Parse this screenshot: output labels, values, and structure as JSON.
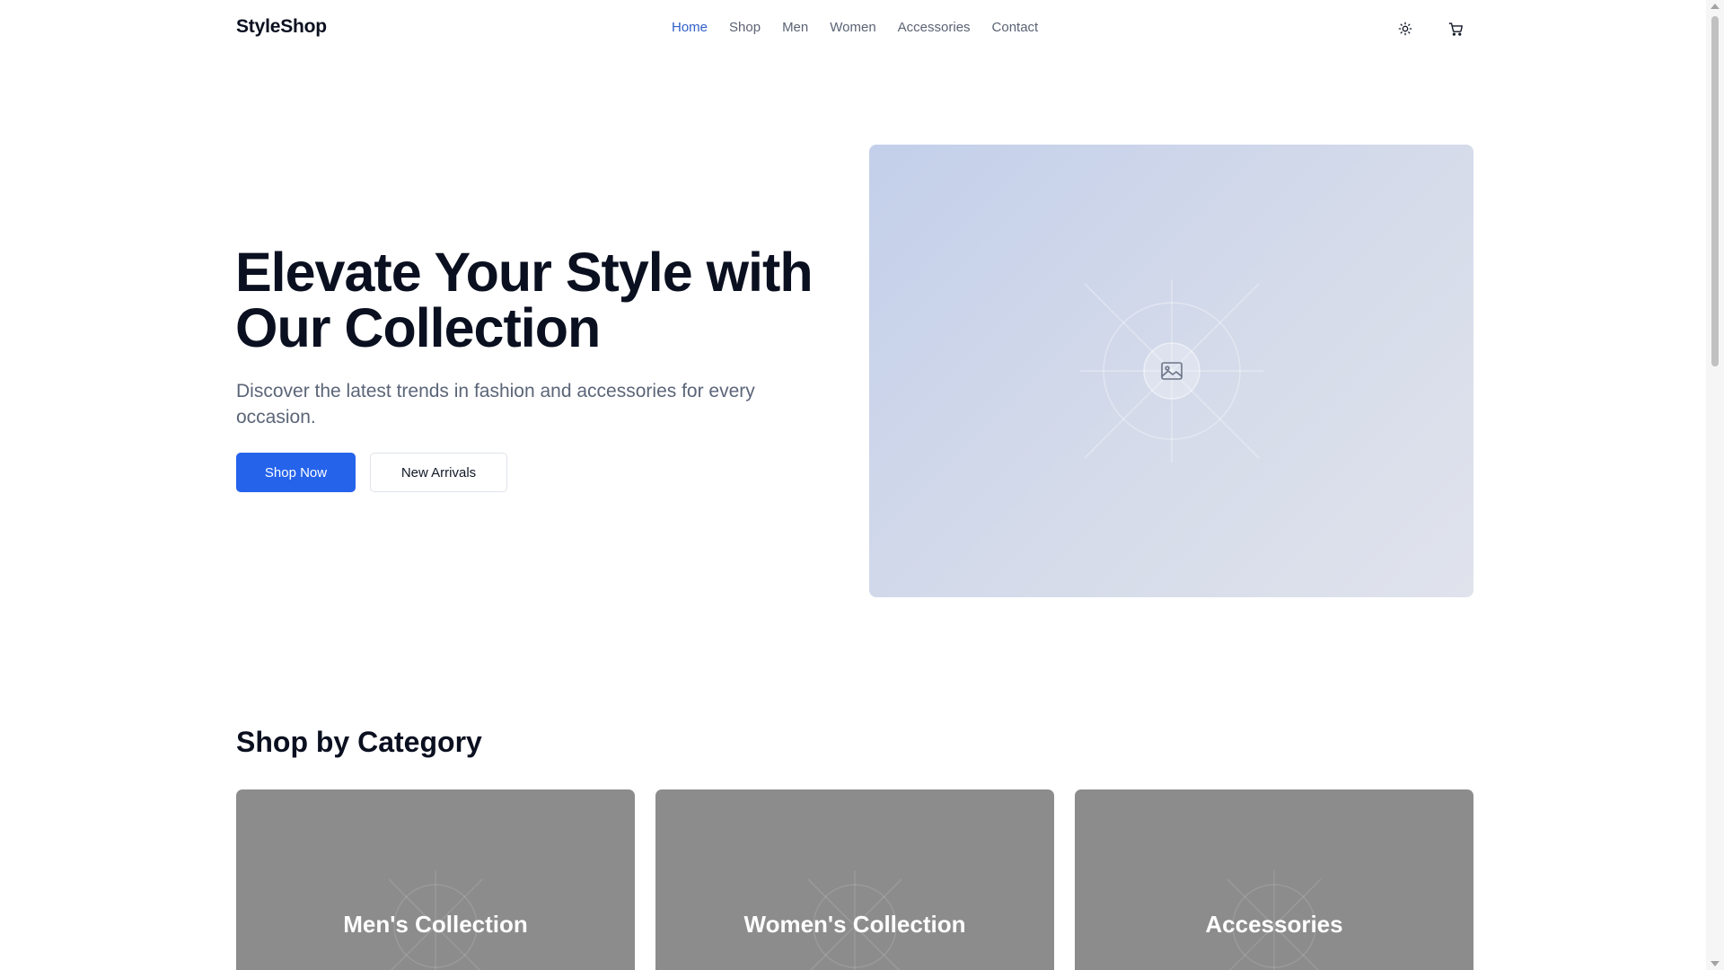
{
  "header": {
    "logo": "StyleShop",
    "nav": [
      {
        "label": "Home",
        "active": true
      },
      {
        "label": "Shop",
        "active": false
      },
      {
        "label": "Men",
        "active": false
      },
      {
        "label": "Women",
        "active": false
      },
      {
        "label": "Accessories",
        "active": false
      },
      {
        "label": "Contact",
        "active": false
      }
    ],
    "icons": {
      "theme": "sun-icon",
      "cart": "cart-icon"
    }
  },
  "hero": {
    "title": "Elevate Your Style with Our Collection",
    "subtitle": "Discover the latest trends in fashion and accessories for every occasion.",
    "primary_button": "Shop Now",
    "secondary_button": "New Arrivals",
    "image_icon": "image-placeholder-icon"
  },
  "categories": {
    "title": "Shop by Category",
    "items": [
      {
        "label": "Men's Collection"
      },
      {
        "label": "Women's Collection"
      },
      {
        "label": "Accessories"
      }
    ]
  },
  "colors": {
    "accent": "#2563eb",
    "nav_active": "#2f5fc9",
    "text_dark": "#0b1020",
    "text_muted": "#5b6578",
    "card_bg": "#8c8c8c"
  }
}
